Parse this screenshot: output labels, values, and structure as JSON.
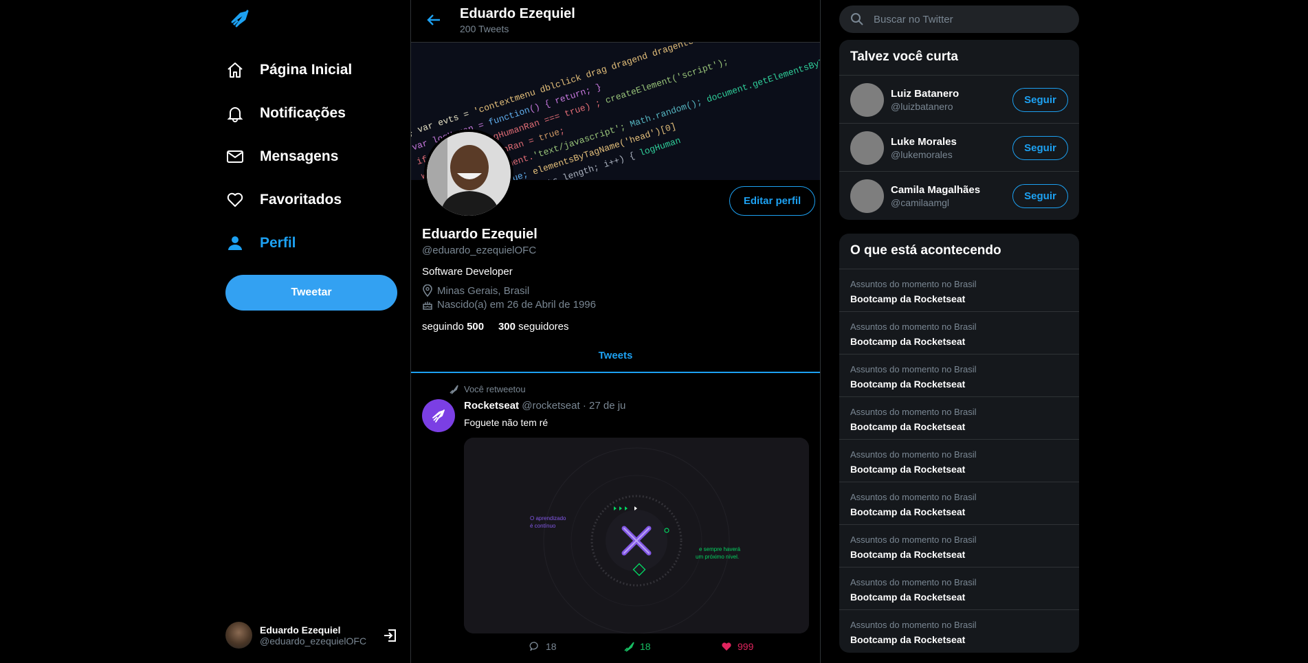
{
  "nav": {
    "items": [
      {
        "label": "Página Inicial",
        "icon": "home-icon"
      },
      {
        "label": "Notificações",
        "icon": "bell-icon"
      },
      {
        "label": "Mensagens",
        "icon": "mail-icon"
      },
      {
        "label": "Favoritados",
        "icon": "heart-icon"
      },
      {
        "label": "Perfil",
        "icon": "person-icon",
        "active": true
      }
    ],
    "tweet_button": "Tweetar",
    "user": {
      "name": "Eduardo Ezequiel",
      "handle": "@eduardo_ezequielOFC"
    }
  },
  "header": {
    "title": "Eduardo Ezequiel",
    "subtitle": "200 Tweets"
  },
  "profile": {
    "name": "Eduardo Ezequiel",
    "handle": "@eduardo_ezequielOFC",
    "bio": "Software Developer",
    "location": "Minas Gerais, Brasil",
    "birthday": "Nascido(a) em 26 de Abril de 1996",
    "following_label": "seguindo",
    "following_count": "500",
    "followers_count": "300",
    "followers_label": "seguidores",
    "edit_button": "Editar perfil"
  },
  "tabs": {
    "active": "Tweets"
  },
  "tweet": {
    "retweet_note": "Você retweetou",
    "author": "Rocketseat",
    "handle": "@rocketseat",
    "dot": "·",
    "date": "27 de ju",
    "text": "Foguete não tem ré",
    "media": {
      "left_text_1": "O aprendizado",
      "left_text_2": "é contínuo",
      "right_text_1": "e sempre haverá",
      "right_text_2": "um próximo nível."
    },
    "comments": "18",
    "retweets": "18",
    "likes": "999"
  },
  "sidebar": {
    "search_placeholder": "Buscar no Twitter",
    "who_title": "Talvez você curta",
    "who": [
      {
        "name": "Luiz Batanero",
        "handle": "@luizbatanero",
        "button": "Seguir"
      },
      {
        "name": "Luke Morales",
        "handle": "@lukemorales",
        "button": "Seguir"
      },
      {
        "name": "Camila Magalhães",
        "handle": "@camilaamgl",
        "button": "Seguir"
      }
    ],
    "trends_title": "O que está acontecendo",
    "trends": [
      {
        "context": "Assuntos do momento no Brasil",
        "topic": "Bootcamp da Rocketseat"
      },
      {
        "context": "Assuntos do momento no Brasil",
        "topic": "Bootcamp da Rocketseat"
      },
      {
        "context": "Assuntos do momento no Brasil",
        "topic": "Bootcamp da Rocketseat"
      },
      {
        "context": "Assuntos do momento no Brasil",
        "topic": "Bootcamp da Rocketseat"
      },
      {
        "context": "Assuntos do momento no Brasil",
        "topic": "Bootcamp da Rocketseat"
      },
      {
        "context": "Assuntos do momento no Brasil",
        "topic": "Bootcamp da Rocketseat"
      },
      {
        "context": "Assuntos do momento no Brasil",
        "topic": "Bootcamp da Rocketseat"
      },
      {
        "context": "Assuntos do momento no Brasil",
        "topic": "Bootcamp da Rocketseat"
      },
      {
        "context": "Assuntos do momento no Brasil",
        "topic": "Bootcamp da Rocketseat"
      }
    ]
  },
  "colors": {
    "accent": "#1da1f2",
    "retweet": "#17bf63",
    "like": "#e0245e",
    "rocketseat": "#7b3fe4"
  }
}
